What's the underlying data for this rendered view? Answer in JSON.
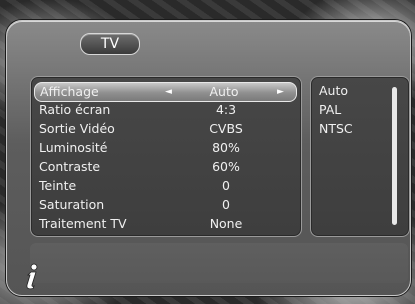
{
  "window": {
    "title": "TV"
  },
  "settings": [
    {
      "label": "Affichage",
      "value": "Auto"
    },
    {
      "label": "Ratio écran",
      "value": "4:3"
    },
    {
      "label": "Sortie Vidéo",
      "value": "CVBS"
    },
    {
      "label": "Luminosité",
      "value": "80%"
    },
    {
      "label": "Contraste",
      "value": "60%"
    },
    {
      "label": "Teinte",
      "value": "0"
    },
    {
      "label": "Saturation",
      "value": "0"
    },
    {
      "label": "Traitement TV",
      "value": "None"
    }
  ],
  "options": [
    "Auto",
    "PAL",
    "NTSC"
  ],
  "icons": {
    "left_arrow": "left-arrow-icon",
    "right_arrow": "right-arrow-icon",
    "info": "info-icon"
  },
  "colors": {
    "selected_highlight": "#a8a8a8",
    "panel_bg": "#444444",
    "text": "#f0f0f0"
  }
}
